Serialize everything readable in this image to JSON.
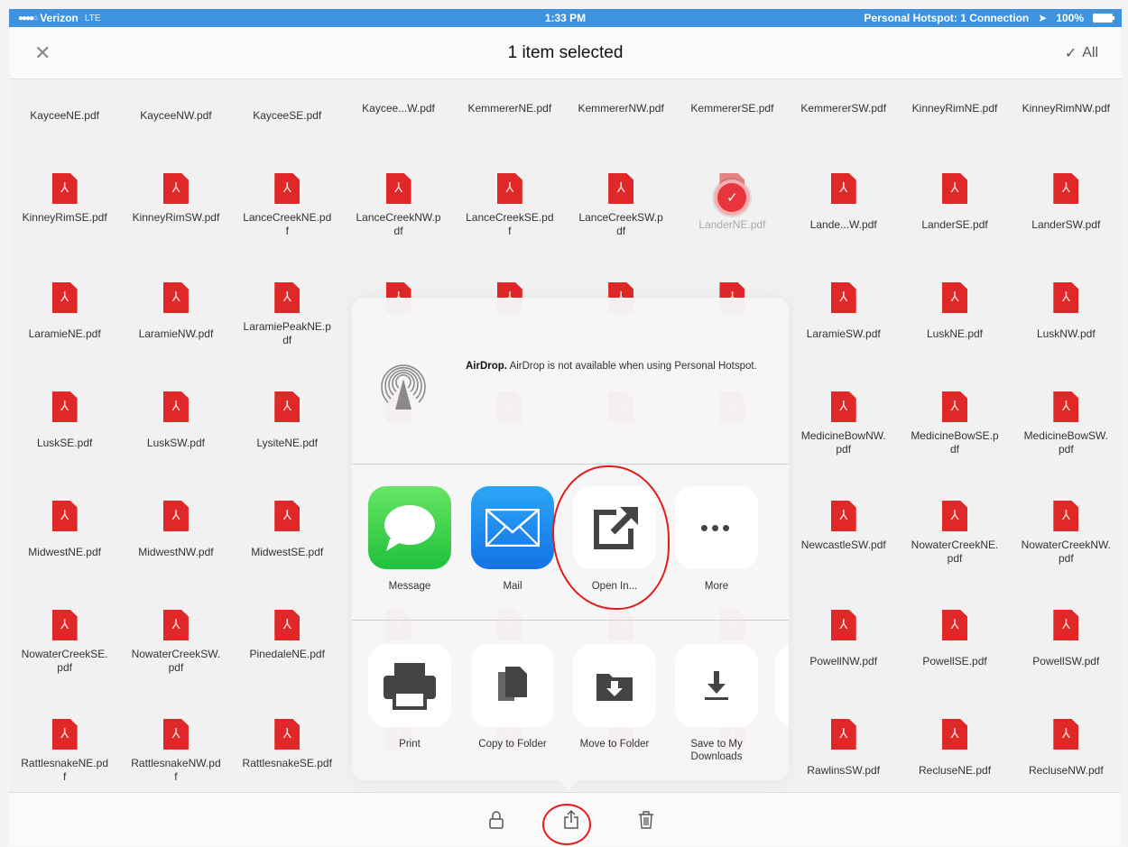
{
  "status": {
    "carrier": "Verizon",
    "network": "LTE",
    "time": "1:33 PM",
    "hotspot": "Personal Hotspot: 1 Connection",
    "battery": "100%"
  },
  "nav": {
    "close_icon": "✕",
    "title": "1 item selected",
    "all_label": "All"
  },
  "files": [
    [
      "KayceeNE.pdf",
      "KayceeNW.pdf",
      "KayceeSE.pdf",
      "Kaycee...W.pdf",
      "KemmererNE.pdf",
      "KemmererNW.pdf",
      "KemmererSE.pdf",
      "KemmererSW.pdf",
      "KinneyRimNE.pdf",
      "KinneyRimNW.pdf"
    ],
    [
      "KinneyRimSE.pdf",
      "KinneyRimSW.pdf",
      "LanceCreekNE.pdf",
      "LanceCreekNW.pdf",
      "LanceCreekSE.pdf",
      "LanceCreekSW.pdf",
      "LanderNE.pdf",
      "Lande...W.pdf",
      "LanderSE.pdf",
      "LanderSW.pdf"
    ],
    [
      "LaramieNE.pdf",
      "LaramieNW.pdf",
      "LaramiePeakNE.pdf",
      "",
      "",
      "",
      "",
      "LaramieSW.pdf",
      "LuskNE.pdf",
      "LuskNW.pdf"
    ],
    [
      "LuskSE.pdf",
      "LuskSW.pdf",
      "LysiteNE.pdf",
      "",
      "",
      "",
      "",
      "MedicineBowNW.pdf",
      "MedicineBowSE.pdf",
      "MedicineBowSW.pdf"
    ],
    [
      "MidwestNE.pdf",
      "MidwestNW.pdf",
      "MidwestSE.pdf",
      "",
      "",
      "",
      "",
      "NewcastleSW.pdf",
      "NowaterCreekNE.pdf",
      "NowaterCreekNW.pdf"
    ],
    [
      "NowaterCreekSE.pdf",
      "NowaterCreekSW.pdf",
      "PinedaleNE.pdf",
      "",
      "",
      "",
      "",
      "PowellNW.pdf",
      "PowellSE.pdf",
      "PowellSW.pdf"
    ],
    [
      "RattlesnakeNE.pdf",
      "RattlesnakeNW.pdf",
      "RattlesnakeSE.pdf",
      "",
      "",
      "",
      "",
      "RawlinsSW.pdf",
      "RecluseNE.pdf",
      "RecluseNW.pdf"
    ]
  ],
  "selected_file": "LanderNE.pdf",
  "share_sheet": {
    "airdrop_title": "AirDrop.",
    "airdrop_text": "AirDrop is not available when using Personal Hotspot.",
    "apps": {
      "message": "Message",
      "mail": "Mail",
      "open_in": "Open In...",
      "more": "More"
    },
    "actions": {
      "print": "Print",
      "copy": "Copy to Folder",
      "move": "Move to Folder",
      "save": "Save to My Downloads"
    }
  },
  "colors": {
    "status_bar": "#3d93de",
    "pdf_red": "#e02828",
    "annotation_red": "#e41b1b"
  }
}
